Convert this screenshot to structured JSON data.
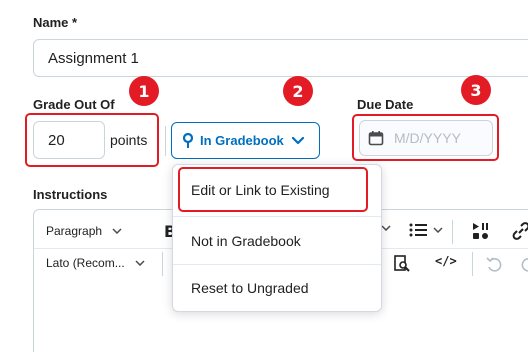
{
  "name": {
    "label": "Name",
    "required_mark": "*",
    "value": "Assignment 1"
  },
  "grade": {
    "label": "Grade Out Of",
    "value": "20",
    "unit": "points"
  },
  "gradebook": {
    "button_label": "In Gradebook"
  },
  "due_date": {
    "label": "Due Date",
    "placeholder": "M/D/YYYY"
  },
  "instructions": {
    "label": "Instructions",
    "toolbar": {
      "format_select": "Paragraph",
      "font_select": "Lato (Recom..."
    }
  },
  "menu": {
    "items": [
      {
        "label": "Edit or Link to Existing"
      },
      {
        "label": "Not in Gradebook"
      },
      {
        "label": "Reset to Ungraded"
      }
    ]
  },
  "callouts": [
    "1",
    "2",
    "3"
  ],
  "colors": {
    "accent": "#006fbf",
    "callout": "#e21b24"
  }
}
